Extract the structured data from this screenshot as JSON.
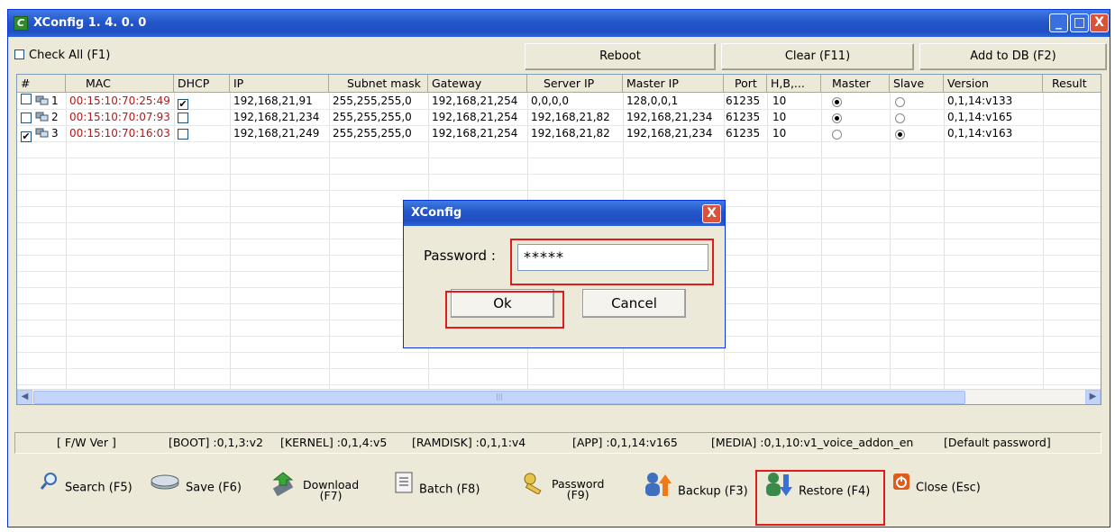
{
  "window": {
    "title": "XConfig 1. 4. 0. 0",
    "min": "_",
    "max": "□",
    "close": "X"
  },
  "toolbar": {
    "check_all": "Check All (F1)",
    "reboot": "Reboot",
    "clear": "Clear (F11)",
    "add_to_db": "Add to DB (F2)"
  },
  "table": {
    "columns": [
      "#",
      "MAC",
      "DHCP",
      "IP",
      "Subnet mask",
      "Gateway",
      "Server IP",
      "Master IP",
      "Port",
      "H,B,...",
      "Master",
      "Slave",
      "Version",
      "Result"
    ],
    "rows": [
      {
        "num": "1",
        "checked": false,
        "mac": "00:15:10:70:25:49",
        "dhcp": true,
        "ip": "192,168,21,91",
        "subnet": "255,255,255,0",
        "gateway": "192,168,21,254",
        "server_ip": "0,0,0,0",
        "master_ip": "128,0,0,1",
        "port": "61235",
        "hb": "10",
        "master": true,
        "slave": false,
        "version": "0,1,14:v133",
        "result": ""
      },
      {
        "num": "2",
        "checked": false,
        "mac": "00:15:10:70:07:93",
        "dhcp": false,
        "ip": "192,168,21,234",
        "subnet": "255,255,255,0",
        "gateway": "192,168,21,254",
        "server_ip": "192,168,21,82",
        "master_ip": "192,168,21,234",
        "port": "61235",
        "hb": "10",
        "master": true,
        "slave": false,
        "version": "0,1,14:v165",
        "result": ""
      },
      {
        "num": "3",
        "checked": true,
        "mac": "00:15:10:70:16:03",
        "dhcp": false,
        "ip": "192,168,21,249",
        "subnet": "255,255,255,0",
        "gateway": "192,168,21,254",
        "server_ip": "192,168,21,82",
        "master_ip": "192,168,21,234",
        "port": "61235",
        "hb": "10",
        "master": false,
        "slave": true,
        "version": "0,1,14:v163",
        "result": ""
      }
    ]
  },
  "status": {
    "fw": "[ F/W Ver ]",
    "boot": "[BOOT] :0,1,3:v2",
    "kernel": "[KERNEL] :0,1,4:v5",
    "ramdisk": "[RAMDISK] :0,1,1:v4",
    "app": "[APP] :0,1,14:v165",
    "media": "[MEDIA] :0,1,10:v1_voice_addon_en",
    "default_pw": "[Default password]"
  },
  "buttons": {
    "search": "Search (F5)",
    "save": "Save (F6)",
    "download_1": "Download",
    "download_2": "(F7)",
    "batch": "Batch (F8)",
    "password_1": "Password",
    "password_2": "(F9)",
    "backup": "Backup (F3)",
    "restore": "Restore (F4)",
    "close": "Close (Esc)"
  },
  "dialog": {
    "title": "XConfig",
    "close": "X",
    "password_label": "Password :",
    "password_value": "*****",
    "ok": "Ok",
    "cancel": "Cancel"
  },
  "colors": {
    "accent_red": "#e01b1b",
    "titlebar": "#2456c8",
    "mac_text": "#b01a1a"
  }
}
